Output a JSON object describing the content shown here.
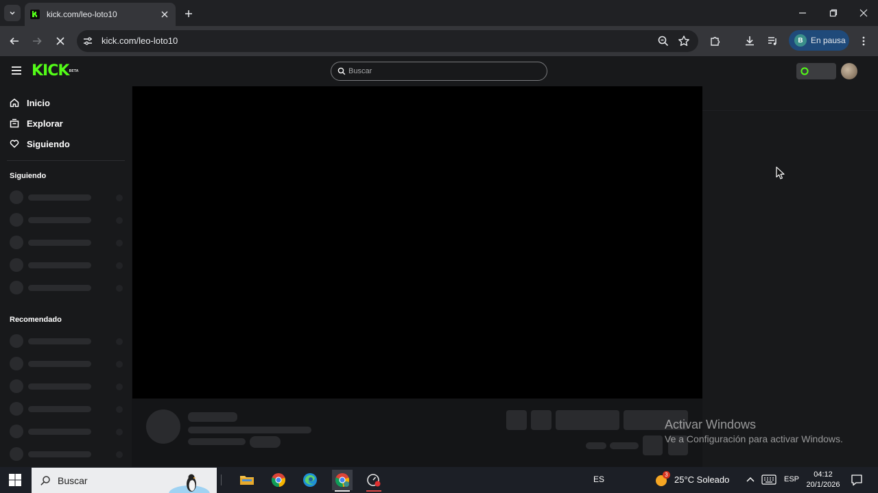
{
  "browser": {
    "tab_title": "kick.com/leo-loto10",
    "url": "kick.com/leo-loto10",
    "profile_initial": "B",
    "profile_status": "En pausa"
  },
  "kick": {
    "logo_text": "KICK",
    "logo_badge": "BETA",
    "search_placeholder": "Buscar",
    "nav": [
      {
        "label": "Inicio",
        "icon": "home-icon"
      },
      {
        "label": "Explorar",
        "icon": "compass-icon"
      },
      {
        "label": "Siguiendo",
        "icon": "heart-icon"
      }
    ],
    "following_title": "Siguiendo",
    "recommended_title": "Recomendado",
    "brand_color": "#53fc18"
  },
  "watermark": {
    "line1": "Activar Windows",
    "line2": "Ve a Configuración para activar Windows."
  },
  "taskbar": {
    "search_label": "Buscar",
    "lang_short": "ES",
    "weather_badge": "3",
    "weather": "25°C Soleado",
    "input_lang": "ESP",
    "time": "04:12",
    "date": "20/1/2026"
  }
}
